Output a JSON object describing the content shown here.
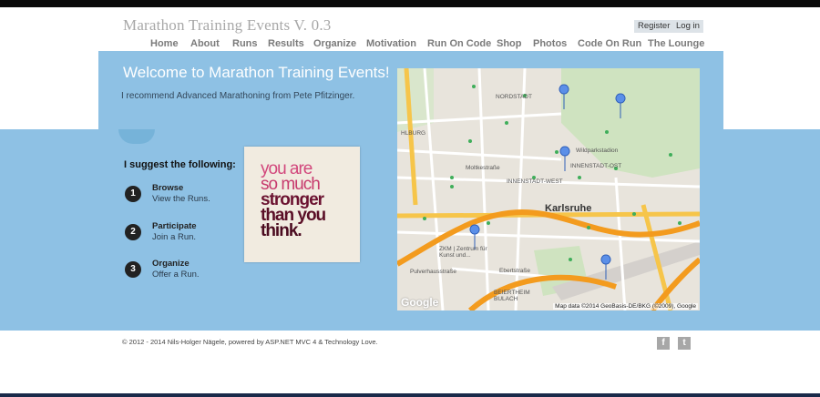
{
  "site": {
    "title": "Marathon Training Events V. 0.3"
  },
  "account": {
    "register": "Register",
    "login": "Log in"
  },
  "nav": [
    "Home",
    "About",
    "Runs",
    "Results",
    "Organize",
    "Motivation",
    "Run On Code",
    "Shop",
    "Photos",
    "Code On Run",
    "The Lounge"
  ],
  "hero": {
    "title": "Welcome to Marathon Training Events!",
    "subtitle": "I recommend Advanced Marathoning from Pete Pfitzinger."
  },
  "suggest": {
    "title": "I suggest the following:",
    "steps": [
      {
        "num": "1",
        "title": "Browse",
        "desc": "View the Runs."
      },
      {
        "num": "2",
        "title": "Participate",
        "desc": "Join a Run."
      },
      {
        "num": "3",
        "title": "Organize",
        "desc": "Offer a Run."
      }
    ]
  },
  "poster": {
    "lines": [
      "you are",
      "so much",
      "stronger",
      "than you",
      "think."
    ]
  },
  "map": {
    "city": "Karlsruhe",
    "credit": "Map data ©2014 GeoBasis-DE/BKG (©2009), Google",
    "logo": "Google",
    "labels": [
      "NORDSTADT",
      "Moltkestraße",
      "INNENSTADT-WEST",
      "INNENSTADT-OST",
      "Wildparkstadion",
      "ZKM | Zentrum für Kunst und...",
      "Ebertstraße",
      "BEIERTHEIM BULACH",
      "HLBURG",
      "Pulverhausstraße"
    ]
  },
  "footer": {
    "text": "© 2012 - 2014 Nils-Holger Nägele, powered by ASP.NET MVC 4 & Technology Love.",
    "facebook": "f",
    "twitter": "t"
  },
  "colors": {
    "band": "#8ec1e4",
    "poster_pink": "#d2477c",
    "poster_maroon": "#5a0e26"
  }
}
